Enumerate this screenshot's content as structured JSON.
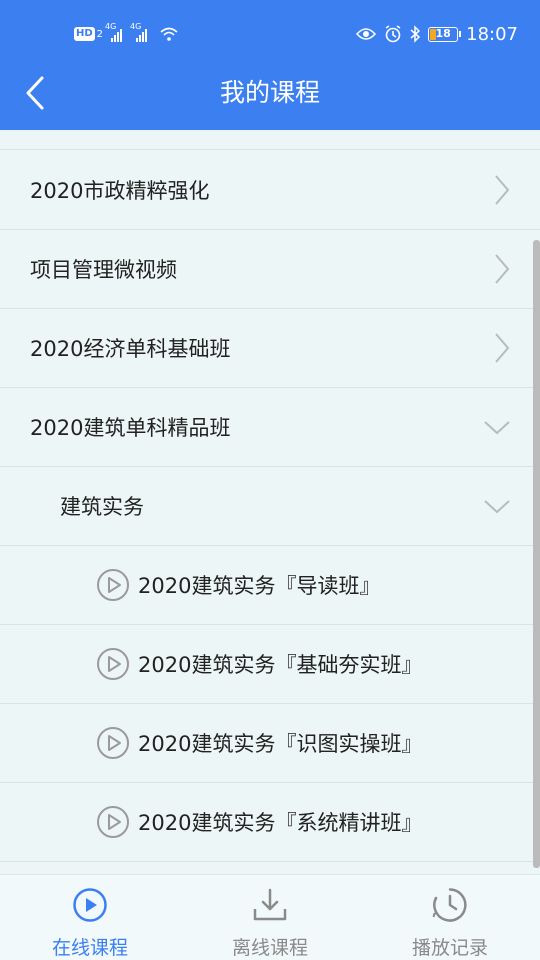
{
  "status_bar": {
    "hd_label": "HD",
    "hd_sub": "2",
    "network_1": "4G",
    "network_2": "4G",
    "battery_level": "18",
    "time": "18:07"
  },
  "header": {
    "title": "我的课程",
    "background_color": "#3b7ff0"
  },
  "courses": [
    {
      "label": "2020市政精粹强化",
      "expanded": false
    },
    {
      "label": "项目管理微视频",
      "expanded": false
    },
    {
      "label": "2020经济单科基础班",
      "expanded": false
    },
    {
      "label": "2020建筑单科精品班",
      "expanded": true
    }
  ],
  "subject": {
    "label": "建筑实务",
    "expanded": true
  },
  "lessons": [
    {
      "label": "2020建筑实务『导读班』"
    },
    {
      "label": "2020建筑实务『基础夯实班』"
    },
    {
      "label": "2020建筑实务『识图实操班』"
    },
    {
      "label": "2020建筑实务『系统精讲班』"
    }
  ],
  "tabs": [
    {
      "label": "在线课程",
      "icon": "play-circle-icon",
      "active": true
    },
    {
      "label": "离线课程",
      "icon": "download-icon",
      "active": false
    },
    {
      "label": "播放记录",
      "icon": "history-clock-icon",
      "active": false
    }
  ],
  "colors": {
    "accent": "#3b7ff0",
    "list_background": "#edf6f6",
    "inactive_tab": "#8a8a8a"
  }
}
